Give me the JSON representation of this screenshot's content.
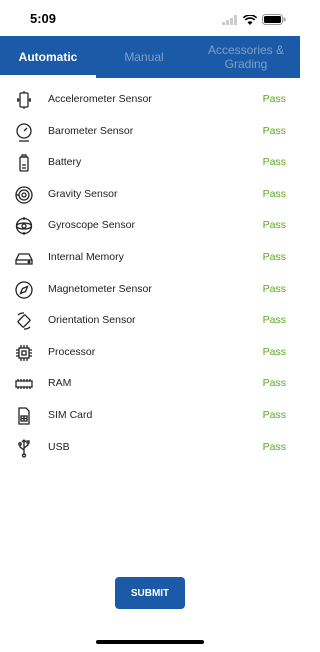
{
  "status_bar": {
    "time": "5:09"
  },
  "tabs": [
    {
      "label": "Automatic",
      "active": true
    },
    {
      "label": "Manual",
      "active": false
    },
    {
      "label": "Accessories & Grading",
      "active": false
    }
  ],
  "tests": [
    {
      "name": "Accelerometer Sensor",
      "status": "Pass",
      "icon": "accelerometer-icon"
    },
    {
      "name": "Barometer Sensor",
      "status": "Pass",
      "icon": "barometer-icon"
    },
    {
      "name": "Battery",
      "status": "Pass",
      "icon": "battery-icon"
    },
    {
      "name": "Gravity Sensor",
      "status": "Pass",
      "icon": "gravity-icon"
    },
    {
      "name": "Gyroscope Sensor",
      "status": "Pass",
      "icon": "gyroscope-icon"
    },
    {
      "name": "Internal Memory",
      "status": "Pass",
      "icon": "memory-icon"
    },
    {
      "name": "Magnetometer Sensor",
      "status": "Pass",
      "icon": "compass-icon"
    },
    {
      "name": "Orientation Sensor",
      "status": "Pass",
      "icon": "orientation-icon"
    },
    {
      "name": "Processor",
      "status": "Pass",
      "icon": "processor-icon"
    },
    {
      "name": "RAM",
      "status": "Pass",
      "icon": "ram-icon"
    },
    {
      "name": "SIM Card",
      "status": "Pass",
      "icon": "sim-card-icon"
    },
    {
      "name": "USB",
      "status": "Pass",
      "icon": "usb-icon"
    }
  ],
  "submit_label": "SUBMIT",
  "colors": {
    "primary": "#1b5aa6",
    "pass": "#5aaa1e",
    "tab_inactive": "#7f9fc8"
  }
}
